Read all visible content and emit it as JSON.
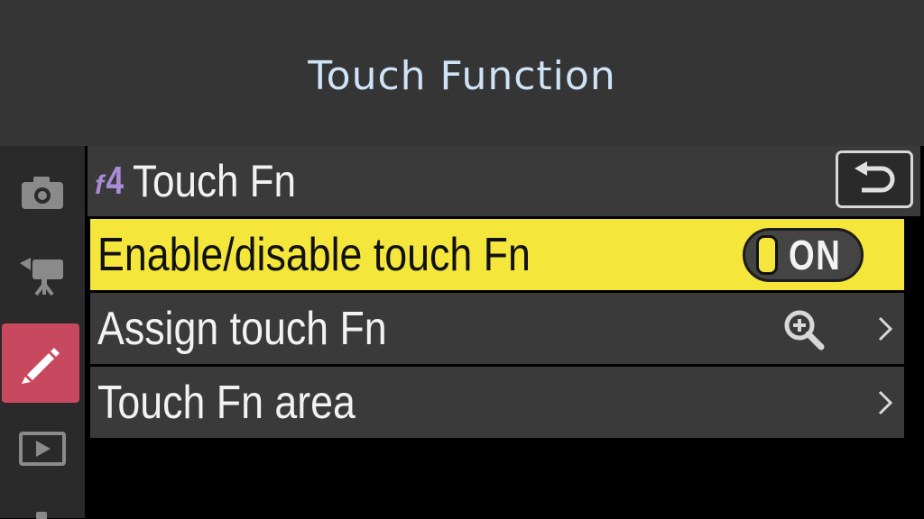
{
  "banner": {
    "title": "Touch Function"
  },
  "sidebar": {
    "tabs": [
      {
        "icon": "camera-icon",
        "active": false
      },
      {
        "icon": "video-camera-icon",
        "active": false
      },
      {
        "icon": "pencil-icon",
        "active": true
      },
      {
        "icon": "playback-icon",
        "active": false
      }
    ]
  },
  "menu": {
    "code_letter": "f",
    "code_number": "4",
    "title": "Touch Fn",
    "back_icon": "return-icon",
    "items": [
      {
        "label": "Enable/disable touch Fn",
        "value": "ON",
        "selected": true
      },
      {
        "label": "Assign touch Fn",
        "icon": "zoom-in-icon",
        "selected": false
      },
      {
        "label": "Touch Fn area",
        "selected": false
      }
    ]
  },
  "colors": {
    "highlight": "#f4e63a",
    "active_tab": "#c8485f",
    "menu_code": "#a98bd8",
    "banner_title": "#cfe3f7"
  }
}
